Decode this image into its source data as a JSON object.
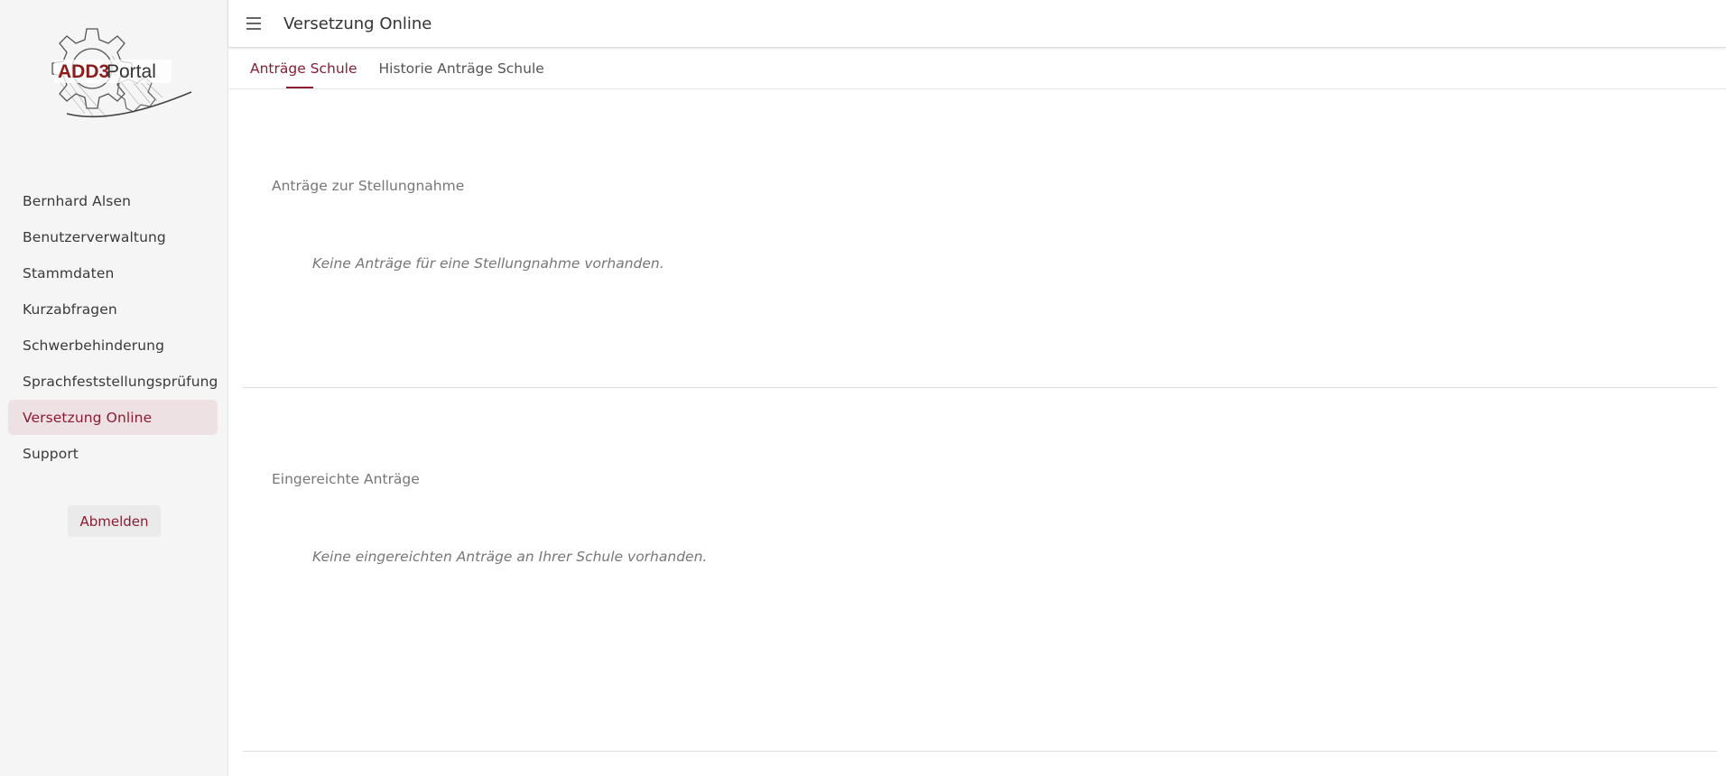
{
  "logo": {
    "text_part1": "ADD3",
    "text_part2": "Portal",
    "brand_color": "#8b1c1c"
  },
  "sidebar": {
    "items": [
      {
        "label": "Bernhard Alsen",
        "active": false
      },
      {
        "label": "Benutzerverwaltung",
        "active": false
      },
      {
        "label": "Stammdaten",
        "active": false
      },
      {
        "label": "Kurzabfragen",
        "active": false
      },
      {
        "label": "Schwerbehinderung",
        "active": false
      },
      {
        "label": "Sprachfeststellungsprüfung",
        "active": false
      },
      {
        "label": "Versetzung Online",
        "active": true
      },
      {
        "label": "Support",
        "active": false
      }
    ],
    "logout_label": "Abmelden"
  },
  "header": {
    "menu_icon": "hamburger-menu-icon",
    "title": "Versetzung Online"
  },
  "tabs": [
    {
      "label": "Anträge Schule",
      "active": true
    },
    {
      "label": "Historie Anträge Schule",
      "active": false
    }
  ],
  "sections": [
    {
      "title": "Anträge zur Stellungnahme",
      "empty_text": "Keine Anträge für eine Stellungnahme vorhanden."
    },
    {
      "title": "Eingereichte Anträge",
      "empty_text": "Keine eingereichten Anträge an Ihrer Schule vorhanden."
    }
  ],
  "colors": {
    "accent": "#8b1c33",
    "active_bg": "#ede1e4",
    "sidebar_bg": "#f5f5f5"
  }
}
